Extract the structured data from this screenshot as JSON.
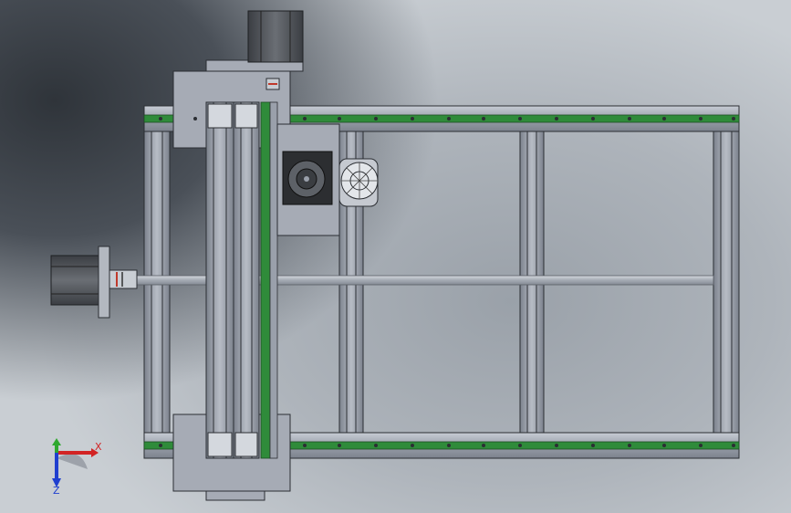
{
  "view": {
    "title": "",
    "background_top_left": "#2f343a",
    "background_center": "#9aa1a9",
    "background_edge": "#c9ced3"
  },
  "model": {
    "frame_color": "#8e94a0",
    "frame_edge": "#2b2e33",
    "rail_color": "#2f8b3a",
    "gantry_plate_color": "#a6abb5",
    "motor_body_color": "#4a4d52"
  },
  "triad": {
    "x_label": "X",
    "z_label": "Z",
    "x_color": "#d22424",
    "y_color": "#2fa82f",
    "z_color": "#1f3fcf",
    "icons": [
      "x-axis-icon",
      "y-axis-icon",
      "z-axis-icon"
    ]
  }
}
